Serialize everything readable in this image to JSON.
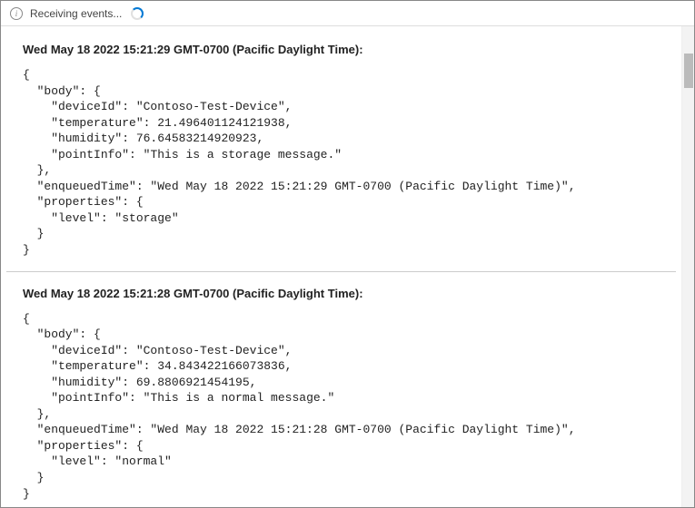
{
  "status": {
    "text": "Receiving events..."
  },
  "events": [
    {
      "timestamp": "Wed May 18 2022 15:21:29 GMT-0700 (Pacific Daylight Time)",
      "body": {
        "deviceId": "Contoso-Test-Device",
        "temperature": 21.496401124121938,
        "humidity": 76.64583214920923,
        "pointInfo": "This is a storage message."
      },
      "enqueuedTime": "Wed May 18 2022 15:21:29 GMT-0700 (Pacific Daylight Time)",
      "properties": {
        "level": "storage"
      }
    },
    {
      "timestamp": "Wed May 18 2022 15:21:28 GMT-0700 (Pacific Daylight Time)",
      "body": {
        "deviceId": "Contoso-Test-Device",
        "temperature": 34.843422166073836,
        "humidity": 69.8806921454195,
        "pointInfo": "This is a normal message."
      },
      "enqueuedTime": "Wed May 18 2022 15:21:28 GMT-0700 (Pacific Daylight Time)",
      "properties": {
        "level": "normal"
      }
    }
  ]
}
